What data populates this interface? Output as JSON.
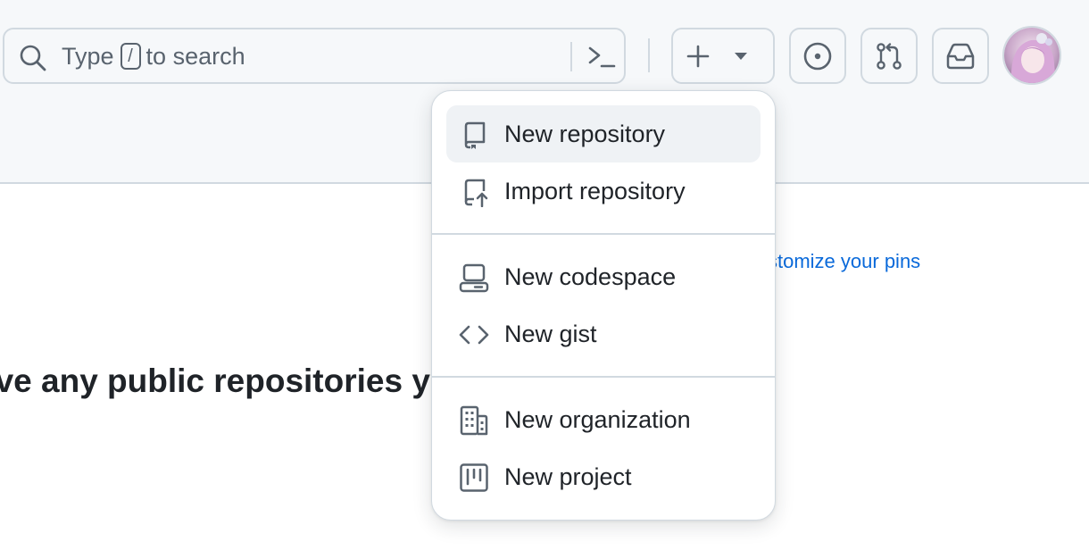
{
  "header": {
    "search": {
      "prefix": "Type",
      "shortcut_key": "/",
      "suffix": "to search"
    },
    "buttons": {
      "create_new": "plus-icon",
      "create_dropdown": "triangle-down-icon",
      "issues": "issue-opened-icon",
      "pull_requests": "git-pull-request-icon",
      "inbox": "inbox-icon"
    },
    "avatar": "user-avatar"
  },
  "background": {
    "customize_link": "stomize your pins",
    "heading": "ave any public repositories y"
  },
  "create_menu": {
    "items": [
      {
        "label": "New repository",
        "icon": "repo-icon"
      },
      {
        "label": "Import repository",
        "icon": "repo-push-icon"
      },
      {
        "label": "New codespace",
        "icon": "codespaces-icon"
      },
      {
        "label": "New gist",
        "icon": "code-icon"
      },
      {
        "label": "New organization",
        "icon": "organization-icon"
      },
      {
        "label": "New project",
        "icon": "project-icon"
      }
    ]
  },
  "colors": {
    "header_bg": "#f6f8fa",
    "border": "#d1d9e0",
    "icon": "#59636e",
    "text": "#1f2328",
    "link": "#0969da",
    "hover_bg": "#eff2f5"
  }
}
